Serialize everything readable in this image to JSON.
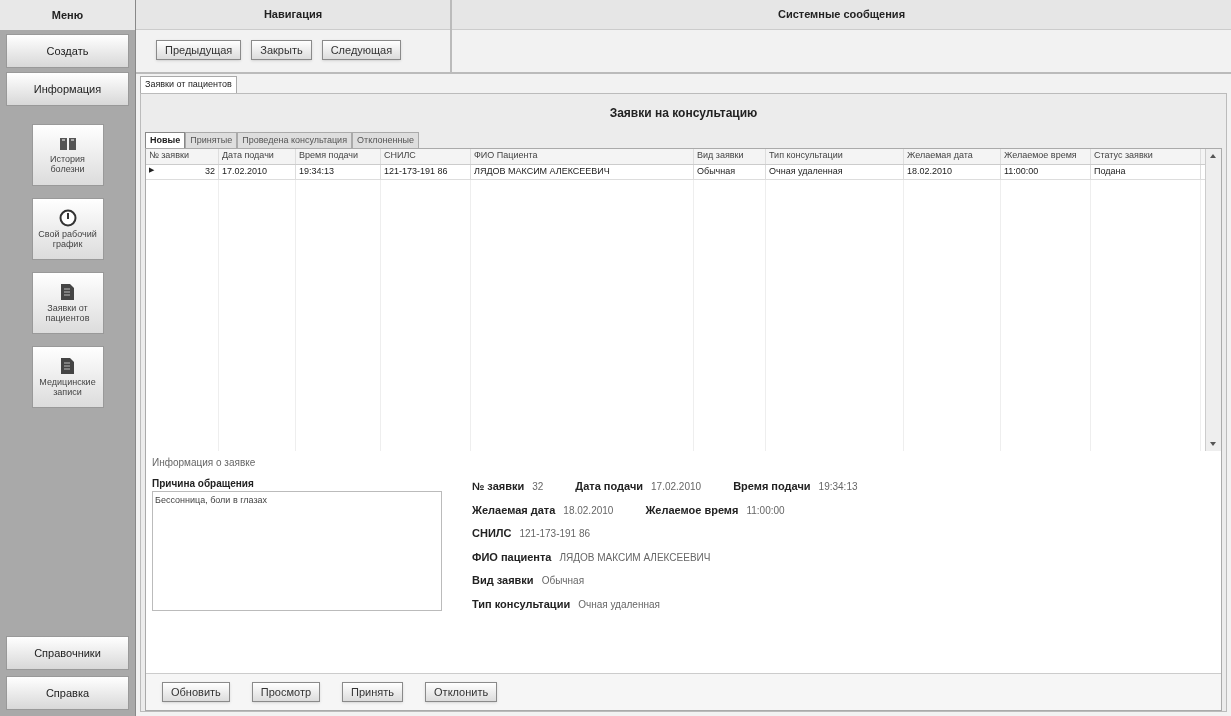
{
  "menu": {
    "title": "Меню",
    "top_buttons": [
      "Создать",
      "Информация"
    ],
    "tiles": [
      {
        "label": "История болезни",
        "kind": "book"
      },
      {
        "label": "Свой рабочий график",
        "kind": "clock"
      },
      {
        "label": "Заявки от пациентов",
        "kind": "doc"
      },
      {
        "label": "Медицинские записи",
        "kind": "doc"
      }
    ],
    "bottom_buttons": [
      "Справочники",
      "Справка"
    ]
  },
  "navigation": {
    "title": "Навигация",
    "buttons": [
      "Предыдущая",
      "Закрыть",
      "Следующая"
    ]
  },
  "system_messages": {
    "title": "Системные сообщения"
  },
  "document_tab": "Заявки от пациентов",
  "page_title": "Заявки на консультацию",
  "tabs": [
    {
      "label": "Новые",
      "selected": true
    },
    {
      "label": "Принятые",
      "selected": false
    },
    {
      "label": "Проведена консультация",
      "selected": false
    },
    {
      "label": "Отклоненные",
      "selected": false
    }
  ],
  "table": {
    "columns": [
      "№ заявки",
      "Дата подачи",
      "Время подачи",
      "СНИЛС",
      "ФИО Пациента",
      "Вид заявки",
      "Тип консультации",
      "Желаемая дата",
      "Желаемое время",
      "Статус заявки"
    ],
    "rows": [
      {
        "marker": "▶",
        "cells": [
          "32",
          "17.02.2010",
          "19:34:13",
          "121-173-191 86",
          "ЛЯДОВ МАКСИМ АЛЕКСЕЕВИЧ",
          "Обычная",
          "Очная удаленная",
          "18.02.2010",
          "11:00:00",
          "Подана"
        ]
      }
    ]
  },
  "details": {
    "title": "Информация о заявке",
    "reason_label": "Причина обращения",
    "reason": "Бессонница, боли в глазах",
    "lines": [
      [
        {
          "label": "№ заявки",
          "value": "32"
        },
        {
          "label": "Дата подачи",
          "value": "17.02.2010"
        },
        {
          "label": "Время подачи",
          "value": "19:34:13"
        }
      ],
      [
        {
          "label": "Желаемая дата",
          "value": "18.02.2010"
        },
        {
          "label": "Желаемое время",
          "value": "11:00:00"
        }
      ],
      [
        {
          "label": "СНИЛС",
          "value": "121-173-191 86"
        }
      ],
      [
        {
          "label": "ФИО пациента",
          "value": "ЛЯДОВ МАКСИМ АЛЕКСЕЕВИЧ"
        }
      ],
      [
        {
          "label": "Вид заявки",
          "value": "Обычная"
        }
      ],
      [
        {
          "label": "Тип консультации",
          "value": "Очная удаленная"
        }
      ]
    ]
  },
  "actions": [
    "Обновить",
    "Просмотр",
    "Принять",
    "Отклонить"
  ]
}
